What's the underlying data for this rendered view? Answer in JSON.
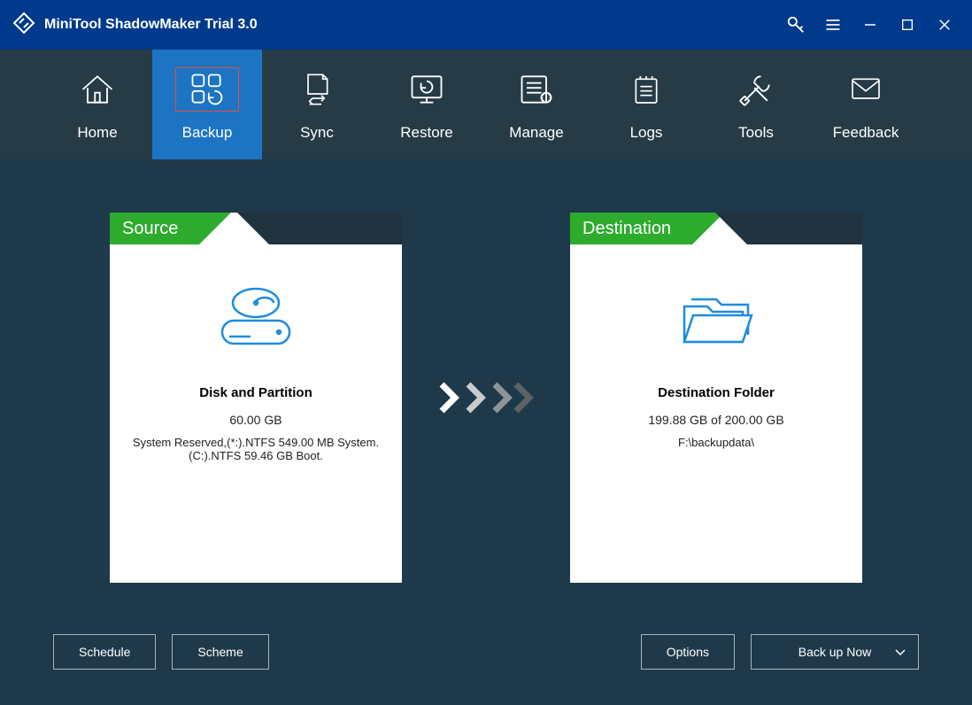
{
  "titlebar": {
    "app_title": "MiniTool ShadowMaker Trial 3.0"
  },
  "nav": {
    "items": [
      {
        "label": "Home"
      },
      {
        "label": "Backup"
      },
      {
        "label": "Sync"
      },
      {
        "label": "Restore"
      },
      {
        "label": "Manage"
      },
      {
        "label": "Logs"
      },
      {
        "label": "Tools"
      },
      {
        "label": "Feedback"
      }
    ],
    "active_index": 1
  },
  "source": {
    "tab_label": "Source",
    "title": "Disk and Partition",
    "size": "60.00 GB",
    "details": "System Reserved,(*:).NTFS 549.00 MB System. (C:).NTFS 59.46 GB Boot."
  },
  "destination": {
    "tab_label": "Destination",
    "title": "Destination Folder",
    "size": "199.88 GB of 200.00 GB",
    "path": "F:\\backupdata\\"
  },
  "buttons": {
    "schedule": "Schedule",
    "scheme": "Scheme",
    "options": "Options",
    "back_up_now": "Back up Now"
  }
}
